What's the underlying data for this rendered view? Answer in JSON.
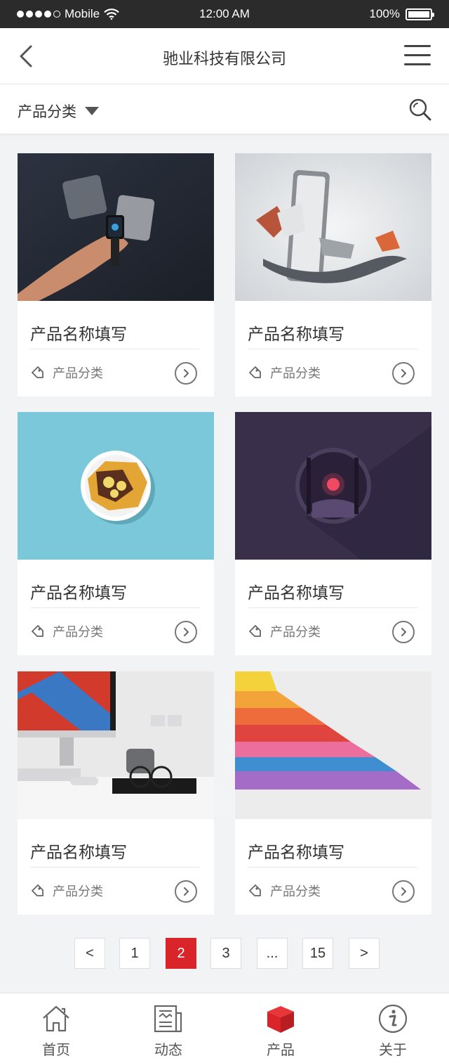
{
  "status_bar": {
    "carrier": "Mobile",
    "time": "12:00 AM",
    "battery": "100%"
  },
  "header": {
    "title": "驰业科技有限公司"
  },
  "filter": {
    "category_label": "产品分类"
  },
  "products": [
    {
      "name": "产品名称填写",
      "category": "产品分类",
      "image": "smartwatch-in-hand"
    },
    {
      "name": "产品名称填写",
      "category": "产品分类",
      "image": "phone-with-horsemen"
    },
    {
      "name": "产品名称填写",
      "category": "产品分类",
      "image": "waffle-plate"
    },
    {
      "name": "产品名称填写",
      "category": "产品分类",
      "image": "forest-moon-circle"
    },
    {
      "name": "产品名称填写",
      "category": "产品分类",
      "image": "desk-with-computer"
    },
    {
      "name": "产品名称填写",
      "category": "产品分类",
      "image": "colored-paper-stack"
    }
  ],
  "pagination": {
    "prev": "<",
    "pages": [
      "1",
      "2",
      "3",
      "...",
      "15"
    ],
    "current": "2",
    "next": ">"
  },
  "tabs": [
    {
      "label": "首页",
      "icon": "home-icon"
    },
    {
      "label": "动态",
      "icon": "news-icon"
    },
    {
      "label": "产品",
      "icon": "product-box-icon"
    },
    {
      "label": "关于",
      "icon": "info-icon"
    }
  ],
  "colors": {
    "accent": "#d9252a",
    "background": "#f2f3f5",
    "status_bar": "#2b2b2b"
  }
}
